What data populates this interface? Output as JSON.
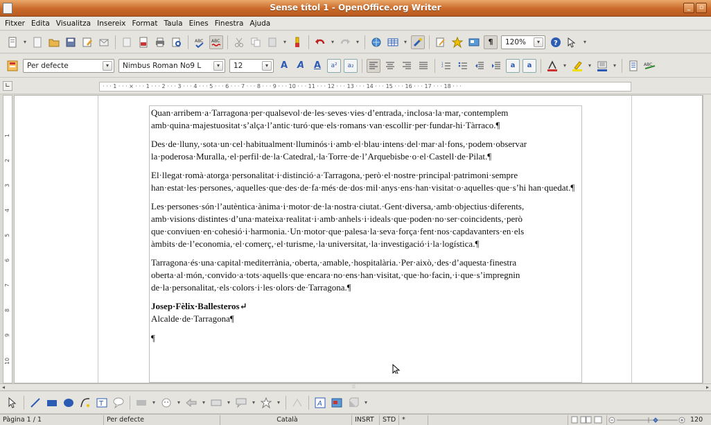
{
  "window": {
    "title": "Sense títol 1 - OpenOffice.org Writer",
    "min_glyph": "_",
    "max_glyph": "▫"
  },
  "menubar": {
    "items": [
      "Fitxer",
      "Edita",
      "Visualitza",
      "Insereix",
      "Format",
      "Taula",
      "Eines",
      "Finestra",
      "Ajuda"
    ]
  },
  "standard_toolbar": {
    "zoom_value": "120%"
  },
  "format_toolbar": {
    "paragraph_style": "Per defecte",
    "font_name": "Nimbus Roman No9 L",
    "font_size": "12"
  },
  "ruler": {
    "text": "· · · 1 · · · ⨯ · · · 1 · · · 2 · · · 3 · · · 4 · · · 5 · · · 6 · · · 7 · · · 8 · · · 9 · · · 10 · · · 11 · · · 12 · · · 13 · · · 14 · · · 15 · · · 16 · · · 17 · · · 18 · · ·",
    "vertical_marks": [
      "1",
      "2",
      "3",
      "4",
      "5",
      "6",
      "7",
      "8",
      "9",
      "10"
    ]
  },
  "document": {
    "paragraphs": [
      "Quan·arribem·a·Tarragona·per·qualsevol·de·les·seves·vies·d’entrada,·inclosa·la·mar,·contemplem amb·quina·majestuositat·s’alça·l’antic·turó·que·els·romans·van·escollir·per·fundar-hi·Tàrraco.¶",
      "Des·de·lluny,·sota·un·cel·habitualment·lluminós·i·amb·el·blau·intens·del·mar·al·fons,·podem·observar la·poderosa·Muralla,·el·perfil·de·la·Catedral,·la·Torre·de·l’Arquebisbe·o·el·Castell·de·Pilat.¶",
      "El·llegat·romà·atorga·personalitat·i·distinció·a·Tarragona,·però·el·nostre·principal·patrimoni·sempre han·estat·les·persones,·aquelles·que·des·de·fa·més·de·dos·mil·anys·ens·han·visitat·o·aquelles·que·s’hi han·quedat.¶",
      "Les·persones·són·l’autèntica·ànima·i·motor·de·la·nostra·ciutat.·Gent·diversa,·amb·objectius·diferents, amb·visions·distintes·d’una·mateixa·realitat·i·amb·anhels·i·ideals·que·poden·no·ser·coincidents,·però que·conviuen·en·cohesió·i·harmonia.·Un·motor·que·palesa·la·seva·força·fent·nos·capdavanters·en·els àmbits·de·l’economia,·el·comerç,·el·turisme,·la·universitat,·la·investigació·i·la·logística.¶",
      "Tarragona·és·una·capital·mediterrània,·oberta,·amable,·hospitalària.·Per·això,·des·d’aquesta·finestra oberta·al·món,·convido·a·tots·aquells·que·encara·no·ens·han·visitat,·que·ho·facin,·i·que·s’impregnin de·la·personalitat,·els·colors·i·les·olors·de·Tarragona.¶"
    ],
    "signature_name": "Josep·Fèlix·Ballesteros↵",
    "signature_title": "Alcalde·de·Tarragona¶",
    "empty_paragraph_mark": "¶"
  },
  "statusbar": {
    "page": "Pàgina 1 / 1",
    "page_style": "Per defecte",
    "language": "Català",
    "insert_mode": "INSRT",
    "selection_mode": "STD",
    "modified": "*",
    "zoom": "120"
  },
  "colors": {
    "titlebar": "#c9692a",
    "accent_blue": "#2c5bb4",
    "highlight_yellow": "#f2c200"
  }
}
